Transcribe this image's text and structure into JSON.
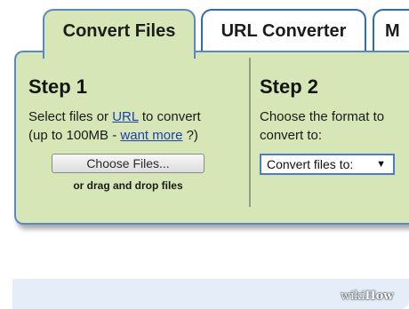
{
  "tabs": [
    {
      "label": "Convert Files",
      "active": true
    },
    {
      "label": "URL Converter",
      "active": false
    },
    {
      "label": "M",
      "active": false
    }
  ],
  "step1": {
    "title": "Step 1",
    "text_before_url": "Select files or ",
    "url_link": "URL",
    "text_after_url": " to convert",
    "text_limit": "(up to 100MB - ",
    "want_more_link": "want more",
    "text_close": " ?)",
    "choose_button": "Choose Files...",
    "drag_text": "or drag and drop files"
  },
  "step2": {
    "title": "Step 2",
    "description": "Choose the format to convert to:",
    "select_value": "Convert files to:",
    "select_arrow": "▼"
  },
  "watermark": {
    "part1": "wiki",
    "part2": "How"
  },
  "colors": {
    "panel_bg": "#d7e6b6",
    "tab_border": "#2f69b7",
    "link": "#1d3fb0"
  }
}
